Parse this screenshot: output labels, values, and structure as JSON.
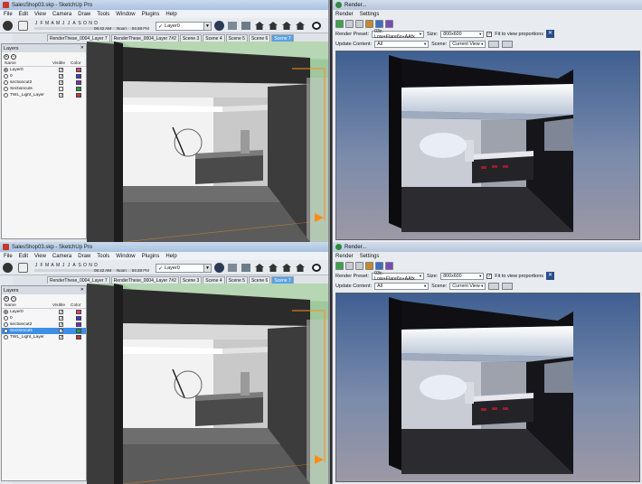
{
  "screens": [
    {
      "sketchup": {
        "title": "SalesShop03.skp - SketchUp Pro",
        "menu": [
          "File",
          "Edit",
          "View",
          "Camera",
          "Draw",
          "Tools",
          "Window",
          "Plugins",
          "Help"
        ],
        "months": [
          "J",
          "F",
          "M",
          "A",
          "M",
          "J",
          "J",
          "A",
          "S",
          "O",
          "N",
          "D"
        ],
        "times": [
          "06:42 AM",
          "Noon",
          "04:48 PM"
        ],
        "layer_combo": "Layer0",
        "scene_tabs": [
          "RenderThese_0004_Layer 7",
          "RenderThese_0004_Layer 7#2",
          "Scene 3",
          "Scene 4",
          "Scene 5",
          "Scene 6",
          "Scene 7"
        ],
        "active_scene": 6,
        "layers_panel": {
          "title": "Layers",
          "columns": [
            "Name",
            "Visible",
            "Color"
          ],
          "rows": [
            {
              "name": "Layer0",
              "active": true,
              "visible": true,
              "color": "#e0426a",
              "selected": false
            },
            {
              "name": "0",
              "active": false,
              "visible": true,
              "color": "#3a3ad6",
              "selected": false
            },
            {
              "name": "sectioncut2",
              "active": false,
              "visible": true,
              "color": "#7a2cc0",
              "selected": false
            },
            {
              "name": "Sectioncuts",
              "active": false,
              "visible": false,
              "color": "#1f9e4a",
              "selected": false
            },
            {
              "name": "TWL_Light_Layer",
              "active": false,
              "visible": true,
              "color": "#c0392b",
              "selected": false
            }
          ]
        }
      },
      "render": {
        "title": "Render...",
        "menu": [
          "Render",
          "Settings"
        ],
        "preset_label": "Render Preset:",
        "preset": "03c. Low+Flare6x+AAfx",
        "size_label": "Size:",
        "size": "800x600",
        "fit_label": "Fit to view proportions",
        "update_label": "Update Content:",
        "update": "All",
        "scene_label": "Scene:",
        "scene": "Current View"
      }
    },
    {
      "sketchup": {
        "title": "SalesShop03.skp - SketchUp Pro",
        "menu": [
          "File",
          "Edit",
          "View",
          "Camera",
          "Draw",
          "Tools",
          "Window",
          "Plugins",
          "Help"
        ],
        "months": [
          "J",
          "F",
          "M",
          "A",
          "M",
          "J",
          "J",
          "A",
          "S",
          "O",
          "N",
          "D"
        ],
        "times": [
          "06:42 AM",
          "Noon",
          "04:48 PM"
        ],
        "layer_combo": "Layer0",
        "scene_tabs": [
          "RenderThese_0004_Layer 7",
          "RenderThese_0004_Layer 7#2",
          "Scene 3",
          "Scene 4",
          "Scene 5",
          "Scene 6",
          "Scene 7"
        ],
        "active_scene": 6,
        "layers_panel": {
          "title": "Layers",
          "columns": [
            "Name",
            "Visible",
            "Color"
          ],
          "rows": [
            {
              "name": "Layer0",
              "active": true,
              "visible": true,
              "color": "#e0426a",
              "selected": false
            },
            {
              "name": "0",
              "active": false,
              "visible": true,
              "color": "#3a3ad6",
              "selected": false
            },
            {
              "name": "sectioncut2",
              "active": false,
              "visible": true,
              "color": "#7a2cc0",
              "selected": false
            },
            {
              "name": "Sectioncuts",
              "active": false,
              "visible": true,
              "color": "#1f9e4a",
              "selected": true
            },
            {
              "name": "TWL_Light_Layer",
              "active": false,
              "visible": true,
              "color": "#c0392b",
              "selected": false
            }
          ]
        }
      },
      "render": {
        "title": "Render...",
        "menu": [
          "Render",
          "Settings"
        ],
        "preset_label": "Render Preset:",
        "preset": "03c. Low+Flare6x+AAfx",
        "size_label": "Size:",
        "size": "800x600",
        "fit_label": "Fit to view proportions",
        "update_label": "Update Content:",
        "update": "All",
        "scene_label": "Scene:",
        "scene": "Current View"
      }
    }
  ]
}
